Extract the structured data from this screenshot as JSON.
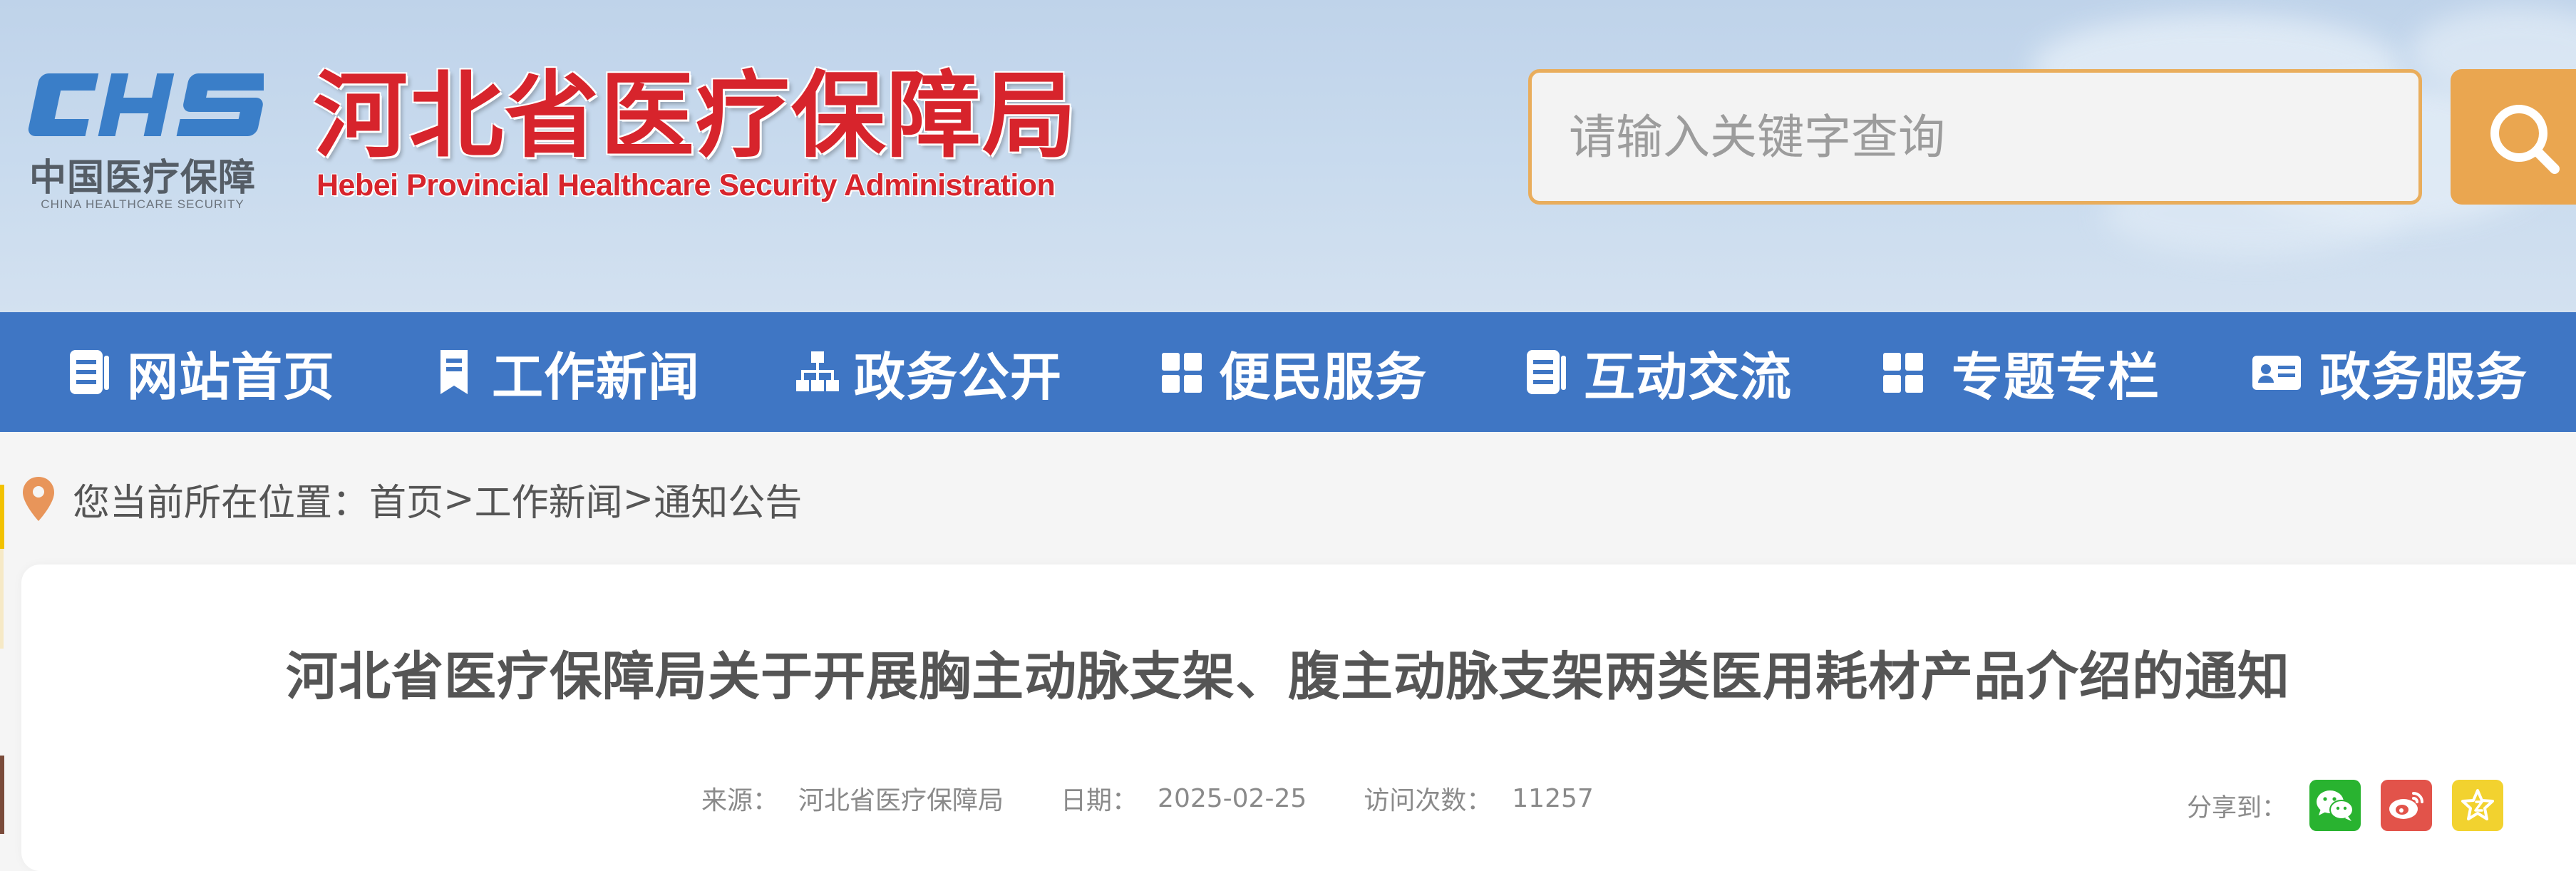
{
  "header": {
    "logo_mark": "CHS",
    "logo_cn": "中国医疗保障",
    "logo_en": "CHINA HEALTHCARE SECURITY",
    "title_cn": "河北省医疗保障局",
    "title_en": "Hebei Provincial Healthcare Security Administration",
    "search": {
      "placeholder": "请输入关键字查询",
      "value": "",
      "button_icon": "search-icon"
    }
  },
  "nav": {
    "items": [
      {
        "label": "网站首页",
        "icon": "document-list-icon"
      },
      {
        "label": "工作新闻",
        "icon": "bookmark-icon"
      },
      {
        "label": "政务公开",
        "icon": "sitemap-icon"
      },
      {
        "label": "便民服务",
        "icon": "grid-icon"
      },
      {
        "label": "互动交流",
        "icon": "document-list-icon"
      },
      {
        "label": "专题专栏",
        "icon": "grid-icon"
      },
      {
        "label": "政务服务",
        "icon": "id-card-icon"
      }
    ]
  },
  "breadcrumb": {
    "prefix": "您当前所在位置：",
    "items": [
      "首页",
      "工作新闻",
      "通知公告"
    ],
    "separator": ">"
  },
  "article": {
    "title": "河北省医疗保障局关于开展胸主动脉支架、腹主动脉支架两类医用耗材产品介绍的通知",
    "source_label": "来源：",
    "source": "河北省医疗保障局",
    "date_label": "日期：",
    "date": "2025-02-25",
    "visits_label": "访问次数：",
    "visits": "11257",
    "share_label": "分享到：",
    "share_targets": [
      "wechat-icon",
      "weibo-icon",
      "star-icon"
    ]
  },
  "colors": {
    "nav_bg": "#3f76c4",
    "brand_red": "#d7242c",
    "search_accent": "#eaa650",
    "wechat": "#29b330",
    "weibo": "#e2534a",
    "favorite": "#f2d22f"
  }
}
